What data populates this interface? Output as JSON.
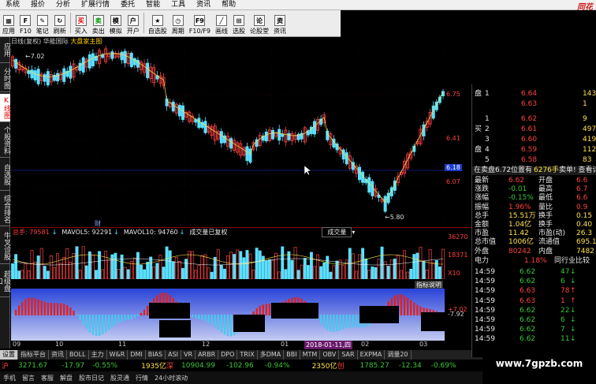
{
  "menu": [
    "系统",
    "报价",
    "分析",
    "扩展行情",
    "委托",
    "智能",
    "工具",
    "资讯",
    "帮助"
  ],
  "brand": "同花",
  "toolbar": [
    {
      "label": "应用",
      "icon": "app-icon",
      "glyph": "▦"
    },
    {
      "label": "F10",
      "icon": "f10-icon",
      "glyph": "F"
    },
    {
      "label": "笔记",
      "icon": "note-icon",
      "glyph": "✎"
    },
    {
      "label": "刷新",
      "icon": "refresh-icon",
      "glyph": "↻"
    },
    {
      "label": "买入",
      "icon": "buy-icon",
      "glyph": "买"
    },
    {
      "label": "卖出",
      "icon": "sell-icon",
      "glyph": "卖"
    },
    {
      "label": "模拟",
      "icon": "simulate-icon",
      "glyph": "模"
    },
    {
      "label": "开户",
      "icon": "open-account-icon",
      "glyph": "户"
    },
    {
      "label": "自选股",
      "icon": "watchlist-icon",
      "glyph": "★"
    },
    {
      "label": "周期",
      "icon": "period-icon",
      "glyph": "◷"
    },
    {
      "label": "F10/F9",
      "icon": "f9-icon",
      "glyph": "F9"
    },
    {
      "label": "画线",
      "icon": "draw-line-icon",
      "glyph": "╱"
    },
    {
      "label": "选股",
      "icon": "stock-picker-icon",
      "glyph": "⊞"
    },
    {
      "label": "论股堂",
      "icon": "forum-icon",
      "glyph": "论"
    },
    {
      "label": "资讯",
      "icon": "news-icon",
      "glyph": "资"
    }
  ],
  "sidetabs": [
    "应用",
    "分时图",
    "K线图",
    "个股资料",
    "自选股",
    "综合排名",
    "牛叉诊股",
    "超级盘口"
  ],
  "chart_title": {
    "prefix": "日线(复权)",
    "stock": "华能国际",
    "suffix": "大盘家主图"
  },
  "price_labels": [
    "6.75",
    "6.41",
    "6.18",
    "6.07"
  ],
  "annotations": {
    "high": "7.02",
    "low": "5.80",
    "fin": "财"
  },
  "vol_header": {
    "total_label": "总手: 79581",
    "mavol5": "MAVOL5: 92291",
    "mavol10": "MAVOL10: 94760",
    "note": "成交量已复权",
    "dropdown": "成交量"
  },
  "vol_scale": [
    "36270",
    "18371",
    "X10"
  ],
  "ind_label": "指标说明",
  "ind_scale": [
    "+7.02",
    "-7.92"
  ],
  "xaxis": [
    "09",
    "10",
    "11",
    "12",
    "01",
    "02",
    "03"
  ],
  "xaxis_highlight": "2018-01-11,四",
  "indicator_tabs": [
    "设置",
    "指标平台",
    "资讯",
    "BOLL",
    "主力",
    "W&R",
    "DMI",
    "BIAS",
    "ASI",
    "VR",
    "ARBR",
    "DPO",
    "TRIX",
    "多DMA",
    "BBI",
    "MTM",
    "OBV",
    "SAR",
    "EXPMA",
    "调量20"
  ],
  "index_bar": {
    "sh_label": "沪",
    "sh_val": "3271.67",
    "sh_chg": "-17.97",
    "sh_pct": "-0.55%",
    "sh_amt": "1935亿",
    "sz_label": "深",
    "sz_val": "10904.99",
    "sz_chg": "-102.96",
    "sz_pct": "-0.94%",
    "sz_amt": "2350亿",
    "cy_label": "创",
    "cy_val": "1785.27",
    "cy_chg": "-12.34",
    "cy_pct": "-0.69%"
  },
  "bottom_tabs": [
    "手机",
    "留言",
    "客服",
    "解盘",
    "股市日记",
    "股灵通",
    "行情",
    "24小时滚动"
  ],
  "watermark": "www.7gpzb.com",
  "order_book": {
    "sell": [
      {
        "side": "盘",
        "lvl": "1",
        "price": "6.64",
        "vol": "143"
      },
      {
        "side": "",
        "lvl": "",
        "price": "6.63",
        "vol": "1"
      }
    ],
    "buy": [
      {
        "lvl": "1",
        "price": "6.62",
        "vol": "9"
      },
      {
        "lvl": "2",
        "price": "6.61",
        "vol": "497"
      },
      {
        "lvl": "3",
        "price": "6.60",
        "vol": "419"
      },
      {
        "lvl": "4",
        "price": "6.59",
        "vol": "112"
      },
      {
        "lvl": "5",
        "price": "6.58",
        "vol": "83"
      }
    ],
    "sell_prefix": "卖",
    "buy_prefix": "买"
  },
  "cmp_bar": {
    "left": "在卖盘6.72位置有",
    "mid": "6276手",
    "right": "卖单! 查看详情"
  },
  "quote_fields": [
    {
      "k1": "最新",
      "v1": "6.62",
      "k2": "开盘",
      "v2": "6.6"
    },
    {
      "k1": "涨跌",
      "v1": "-0.01",
      "k2": "最高",
      "v2": "6.7"
    },
    {
      "k1": "涨幅",
      "v1": "-0.15%",
      "k2": "最低",
      "v2": "6.6"
    },
    {
      "k1": "振幅",
      "v1": "1.96%",
      "k2": "量比",
      "v2": "0.9"
    },
    {
      "k1": "总手",
      "v1": "15.51万",
      "k2": "换手",
      "v2": "0.15"
    },
    {
      "k1": "金额",
      "v1": "1.04亿",
      "k2": "换手",
      "v2": "0.40"
    },
    {
      "k1": "市盈",
      "v1": "11.42",
      "k2": "市盈(动)",
      "v2": "26.3"
    },
    {
      "k1": "总市值",
      "v1": "1006亿",
      "k2": "流通值",
      "v2": "695.1"
    },
    {
      "k1": "外盘",
      "v1": "80242",
      "k2": "内盘",
      "v2": "7482"
    }
  ],
  "sector": {
    "name": "电力",
    "pct": "1.18%",
    "cmp": "同行业比较"
  },
  "ticks": [
    {
      "t": "14:59",
      "p": "6.62",
      "v": "47",
      "d": "down"
    },
    {
      "t": "14:59",
      "p": "6.62",
      "v": "6",
      "d": "down"
    },
    {
      "t": "14:59",
      "p": "6.63",
      "v": "78",
      "d": "up"
    },
    {
      "t": "14:59",
      "p": "6.63",
      "v": "1",
      "d": "up"
    },
    {
      "t": "14:59",
      "p": "6.62",
      "v": "22",
      "d": "down"
    },
    {
      "t": "14:59",
      "p": "6.62",
      "v": "6",
      "d": "down"
    },
    {
      "t": "14:59",
      "p": "6.62",
      "v": "7",
      "d": "down"
    },
    {
      "t": "14:59",
      "p": "6.62",
      "v": "11",
      "d": "down"
    }
  ],
  "colors": {
    "up": "#ff4040",
    "down": "#5ae0ff",
    "ma": "#ffe24a",
    "bg": "#000000"
  }
}
